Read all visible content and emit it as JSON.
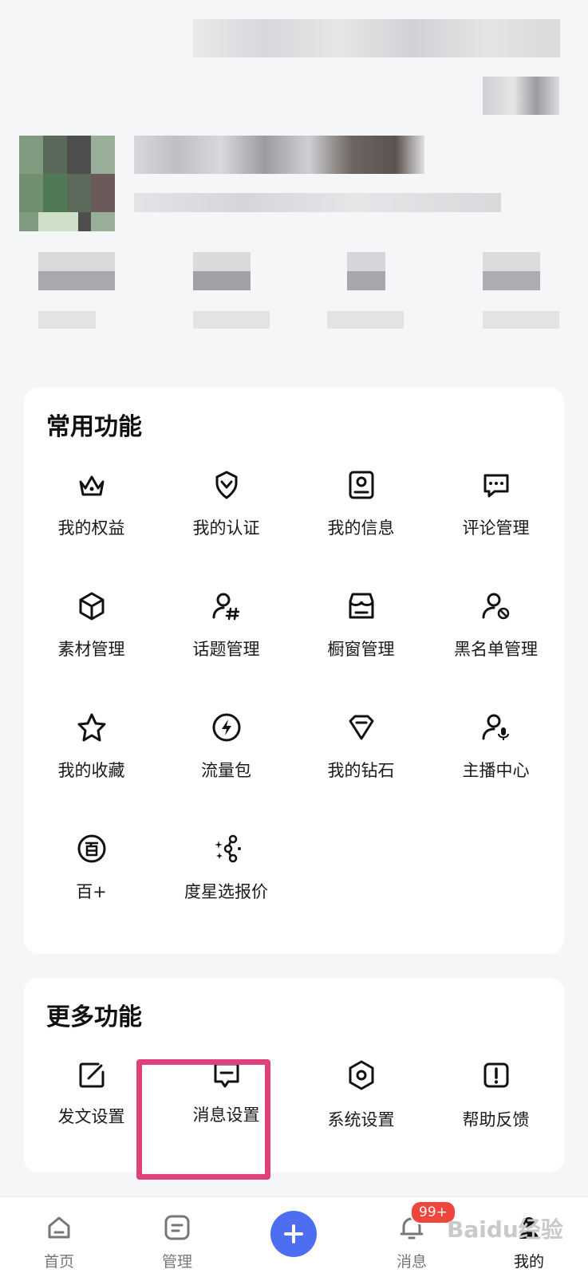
{
  "common_section": {
    "title": "常用功能",
    "items": [
      {
        "label": "我的权益",
        "icon": "crown-icon"
      },
      {
        "label": "我的认证",
        "icon": "verified-badge-icon"
      },
      {
        "label": "我的信息",
        "icon": "profile-card-icon"
      },
      {
        "label": "评论管理",
        "icon": "comment-bubble-icon"
      },
      {
        "label": "素材管理",
        "icon": "cube-icon"
      },
      {
        "label": "话题管理",
        "icon": "user-hashtag-icon"
      },
      {
        "label": "橱窗管理",
        "icon": "storefront-icon"
      },
      {
        "label": "黑名单管理",
        "icon": "user-block-icon"
      },
      {
        "label": "我的收藏",
        "icon": "star-icon"
      },
      {
        "label": "流量包",
        "icon": "lightning-icon"
      },
      {
        "label": "我的钻石",
        "icon": "diamond-icon"
      },
      {
        "label": "主播中心",
        "icon": "user-mic-icon"
      },
      {
        "label": "百+",
        "icon": "bai-plus-icon"
      },
      {
        "label": "度星选报价",
        "icon": "sparkle-nodes-icon"
      }
    ]
  },
  "more_section": {
    "title": "更多功能",
    "items": [
      {
        "label": "发文设置",
        "icon": "edit-square-icon"
      },
      {
        "label": "消息设置",
        "icon": "message-square-icon"
      },
      {
        "label": "系统设置",
        "icon": "settings-hex-icon"
      },
      {
        "label": "帮助反馈",
        "icon": "help-alert-icon"
      }
    ]
  },
  "tabbar": {
    "tabs": [
      {
        "label": "首页",
        "icon": "home-icon"
      },
      {
        "label": "管理",
        "icon": "manage-icon"
      },
      {
        "label": "",
        "icon": "plus-icon"
      },
      {
        "label": "消息",
        "icon": "bell-icon"
      },
      {
        "label": "我的",
        "icon": "user-icon"
      }
    ],
    "badge": "99+",
    "accent": "#4e6ef2"
  },
  "highlight_color": "#e0407c",
  "watermark": "Baidu经验"
}
